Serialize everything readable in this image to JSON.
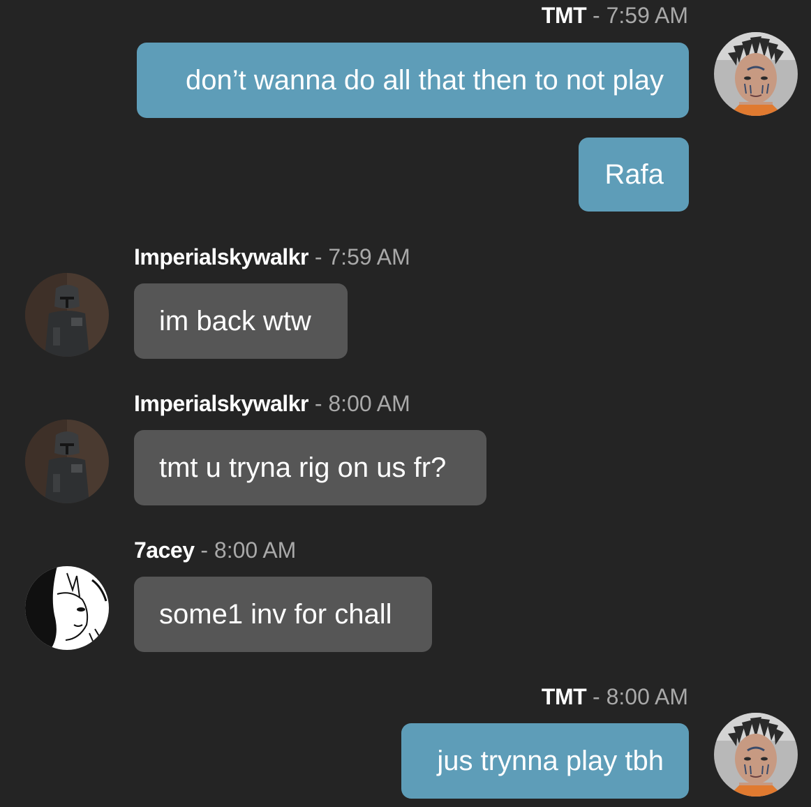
{
  "colors": {
    "background": "#242424",
    "outgoing_bubble": "#5e9db8",
    "incoming_bubble": "#565656",
    "username": "#ffffff",
    "timestamp": "#a9a9a9"
  },
  "separator": "-",
  "messages": [
    {
      "sender": "TMT",
      "time": "7:59 AM",
      "direction": "outgoing",
      "avatar": "tmt-avatar",
      "texts": [
        "don’t wanna do all that then to not play",
        "Rafa"
      ]
    },
    {
      "sender": "Imperialskywalkr",
      "time": "7:59 AM",
      "direction": "incoming",
      "avatar": "helmet-avatar",
      "texts": [
        "im back wtw"
      ]
    },
    {
      "sender": "Imperialskywalkr",
      "time": "8:00 AM",
      "direction": "incoming",
      "avatar": "helmet-avatar",
      "texts": [
        "tmt u tryna rig on us fr?"
      ]
    },
    {
      "sender": "7acey",
      "time": "8:00 AM",
      "direction": "incoming",
      "avatar": "anime-sketch-avatar",
      "texts": [
        "some1 inv for chall"
      ]
    },
    {
      "sender": "TMT",
      "time": "8:00 AM",
      "direction": "outgoing",
      "avatar": "tmt-avatar",
      "texts": [
        "jus trynna play tbh"
      ]
    }
  ]
}
